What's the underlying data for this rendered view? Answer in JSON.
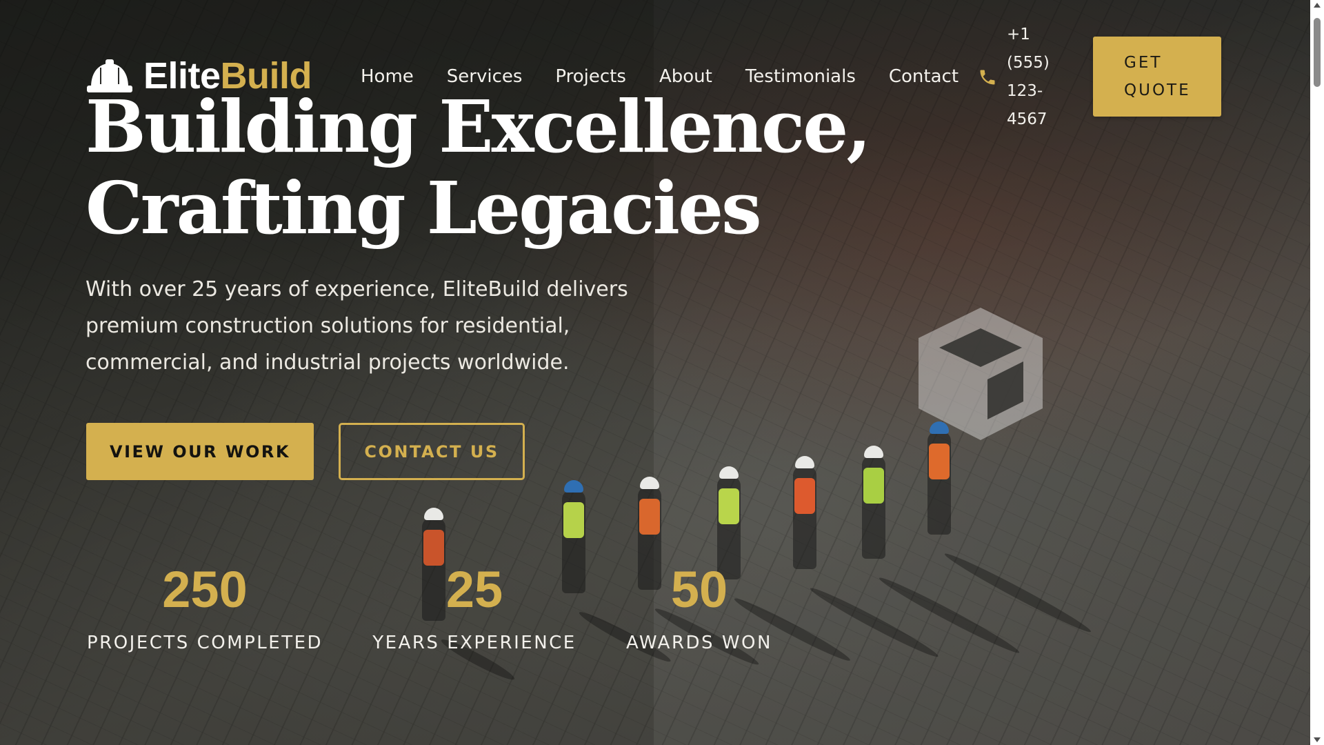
{
  "brand": {
    "name_part1": "Elite",
    "name_part2": "Build",
    "icon": "hard-hat-icon"
  },
  "nav": {
    "items": [
      "Home",
      "Services",
      "Projects",
      "About",
      "Testimonials",
      "Contact"
    ],
    "phone_icon": "phone-icon",
    "phone_lines": [
      "+1",
      "(555)",
      "123-",
      "4567"
    ],
    "cta_lines": [
      "GET",
      "QUOTE"
    ]
  },
  "hero": {
    "title_lines": [
      "Building Excellence,",
      "Crafting Legacies"
    ],
    "subtitle": "With over 25 years of experience, EliteBuild delivers premium construction solutions for residential, commercial, and industrial projects worldwide.",
    "primary_button": "VIEW OUR WORK",
    "secondary_button": "CONTACT US",
    "decoration_icon": "cube-icon"
  },
  "stats": [
    {
      "value": "250",
      "label": "PROJECTS COMPLETED"
    },
    {
      "value": "25",
      "label": "YEARS EXPERIENCE"
    },
    {
      "value": "50",
      "label": "AWARDS WON"
    }
  ],
  "colors": {
    "accent": "#d4b04f",
    "text": "#f3f1ec",
    "dark": "#1c1a14"
  }
}
